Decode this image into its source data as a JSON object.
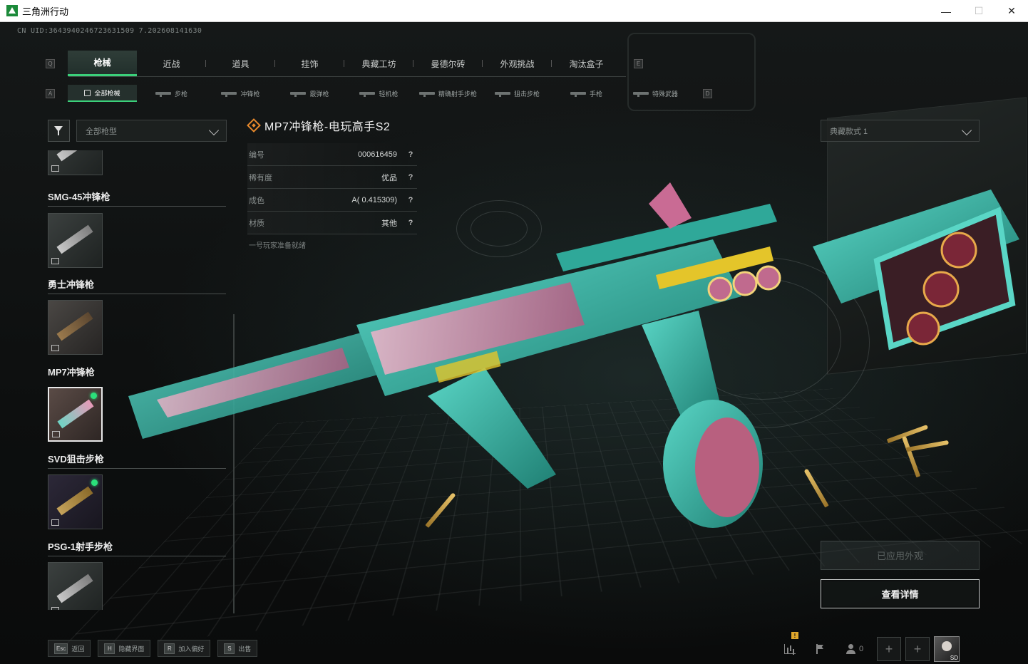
{
  "window": {
    "title": "三角洲行动"
  },
  "uid": "CN UID:3643940246723631509 7.202608141630",
  "tabs_primary": {
    "left_key": "Q",
    "right_key": "E",
    "items": [
      {
        "label": "枪械",
        "active": true
      },
      {
        "label": "近战"
      },
      {
        "label": "道具"
      },
      {
        "label": "挂饰"
      },
      {
        "label": "典藏工坊"
      },
      {
        "label": "曼德尔砖"
      },
      {
        "label": "外观挑战"
      },
      {
        "label": "淘汰盒子"
      }
    ]
  },
  "tabs_secondary": {
    "left_key": "A",
    "right_key": "D",
    "items": [
      {
        "label": "全部枪械",
        "active": true
      },
      {
        "label": "步枪"
      },
      {
        "label": "冲锋枪"
      },
      {
        "label": "霰弹枪"
      },
      {
        "label": "轻机枪"
      },
      {
        "label": "精确射手步枪"
      },
      {
        "label": "狙击步枪"
      },
      {
        "label": "手枪"
      },
      {
        "label": "特殊武器"
      }
    ]
  },
  "filter": {
    "placeholder": "全部枪型"
  },
  "style_select": {
    "value": "典藏款式 1"
  },
  "weapon_list": [
    {
      "name": "SMG-45冲锋枪"
    },
    {
      "name": "勇士冲锋枪"
    },
    {
      "name": "MP7冲锋枪",
      "selected": true
    },
    {
      "name": "SVD狙击步枪"
    },
    {
      "name": "PSG-1射手步枪"
    }
  ],
  "weapon": {
    "title": "MP7冲锋枪-电玩高手S2",
    "rarity_color": "#e88a2c",
    "attributes": [
      {
        "key": "编号",
        "value": "000616459"
      },
      {
        "key": "稀有度",
        "value": "优品"
      },
      {
        "key": "成色",
        "value": "A( 0.415309)"
      },
      {
        "key": "材质",
        "value": "其他"
      }
    ],
    "status": "一号玩家准备就绪"
  },
  "actions": {
    "applied": "已应用外观",
    "detail": "查看详情"
  },
  "bottom_hints": [
    {
      "key": "Esc",
      "label": "返回"
    },
    {
      "key": "H",
      "label": "隐藏界面"
    },
    {
      "key": "R",
      "label": "加入偏好"
    },
    {
      "key": "S",
      "label": "出售"
    }
  ],
  "bottom_right": {
    "badge": "!",
    "friends_count": "0",
    "plus": "+",
    "avatar_label": "SD"
  },
  "colors": {
    "accent": "#3bd07a",
    "skin_teal": "#3fb8a8",
    "skin_pink": "#d98aa8"
  }
}
